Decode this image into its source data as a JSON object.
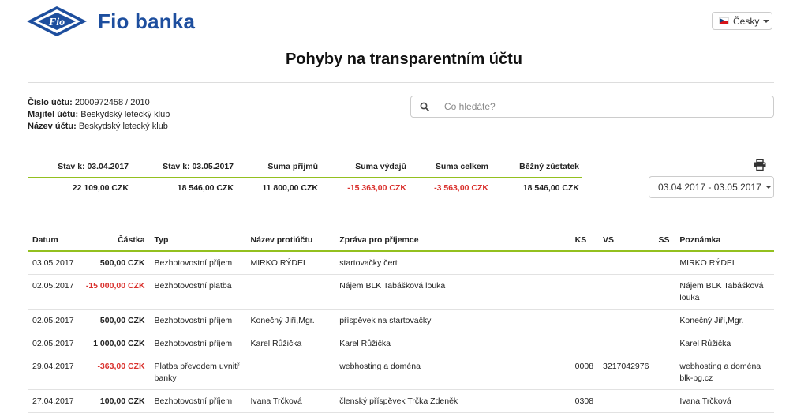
{
  "header": {
    "brand": "Fio banka",
    "language": "Česky"
  },
  "page_title": "Pohyby na transparentním účtu",
  "account": {
    "number_label": "Číslo účtu:",
    "number": "2000972458 / 2010",
    "owner_label": "Majitel účtu:",
    "owner": "Beskydský letecký klub",
    "name_label": "Název účtu:",
    "name": "Beskydský letecký klub"
  },
  "search": {
    "placeholder": "Co hledáte?"
  },
  "summary": {
    "headers": [
      "Stav k: 03.04.2017",
      "Stav k: 03.05.2017",
      "Suma příjmů",
      "Suma výdajů",
      "Suma celkem",
      "Běžný zůstatek"
    ],
    "values": [
      "22 109,00 CZK",
      "18 546,00 CZK",
      "11 800,00 CZK",
      "-15 363,00 CZK",
      "-3 563,00 CZK",
      "18 546,00 CZK"
    ]
  },
  "date_range": "03.04.2017 - 03.05.2017",
  "colors": {
    "accent_green": "#93c01f",
    "negative": "#d9302c",
    "brand_blue": "#1d4e9e"
  },
  "table": {
    "headers": [
      "Datum",
      "Částka",
      "Typ",
      "Název protiúčtu",
      "Zpráva pro příjemce",
      "KS",
      "VS",
      "SS",
      "Poznámka"
    ],
    "rows": [
      [
        "03.05.2017",
        "500,00 CZK",
        "Bezhotovostní příjem",
        "MIRKO RÝDEL",
        "startovačky čert",
        "",
        "",
        "",
        "MIRKO RÝDEL"
      ],
      [
        "02.05.2017",
        "-15 000,00 CZK",
        "Bezhotovostní platba",
        "",
        "Nájem BLK Tabášková louka",
        "",
        "",
        "",
        "Nájem BLK Tabášková louka"
      ],
      [
        "02.05.2017",
        "500,00 CZK",
        "Bezhotovostní příjem",
        "Konečný Jiří,Mgr.",
        "příspěvek na startovačky",
        "",
        "",
        "",
        "Konečný Jiří,Mgr."
      ],
      [
        "02.05.2017",
        "1 000,00 CZK",
        "Bezhotovostní příjem",
        "Karel Růžička",
        "Karel Růžička",
        "",
        "",
        "",
        "Karel Růžička"
      ],
      [
        "29.04.2017",
        "-363,00 CZK",
        "Platba převodem uvnitř banky",
        "",
        "webhosting a doména",
        "0008",
        "3217042976",
        "",
        "webhosting a doména blk-pg.cz"
      ],
      [
        "27.04.2017",
        "100,00 CZK",
        "Bezhotovostní příjem",
        "Ivana Trčková",
        "členský příspěvek Trčka Zdeněk",
        "0308",
        "",
        "",
        "Ivana Trčková"
      ]
    ]
  }
}
